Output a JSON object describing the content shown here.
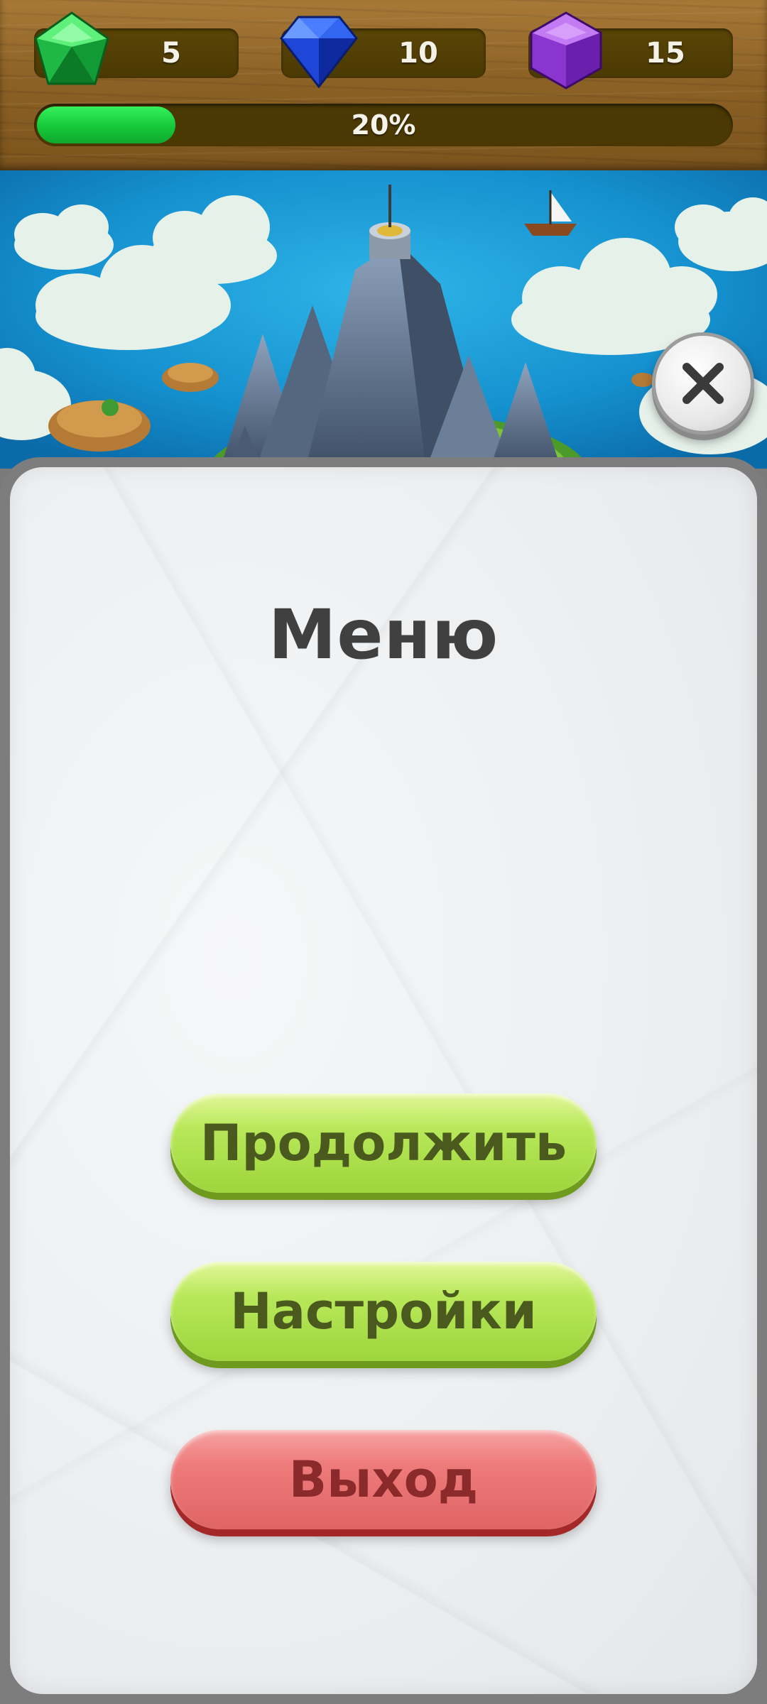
{
  "resources": [
    {
      "name": "green-gem",
      "value": "5",
      "color": "#22c55e"
    },
    {
      "name": "blue-gem",
      "value": "10",
      "color": "#1d4ed8"
    },
    {
      "name": "purple-gem",
      "value": "15",
      "color": "#7e22ce"
    }
  ],
  "progress": {
    "percent_label": "20%",
    "fraction": 0.2
  },
  "menu": {
    "title": "Меню",
    "continue_label": "Продолжить",
    "settings_label": "Настройки",
    "exit_label": "Выход"
  },
  "icons": {
    "close": "close-icon"
  }
}
